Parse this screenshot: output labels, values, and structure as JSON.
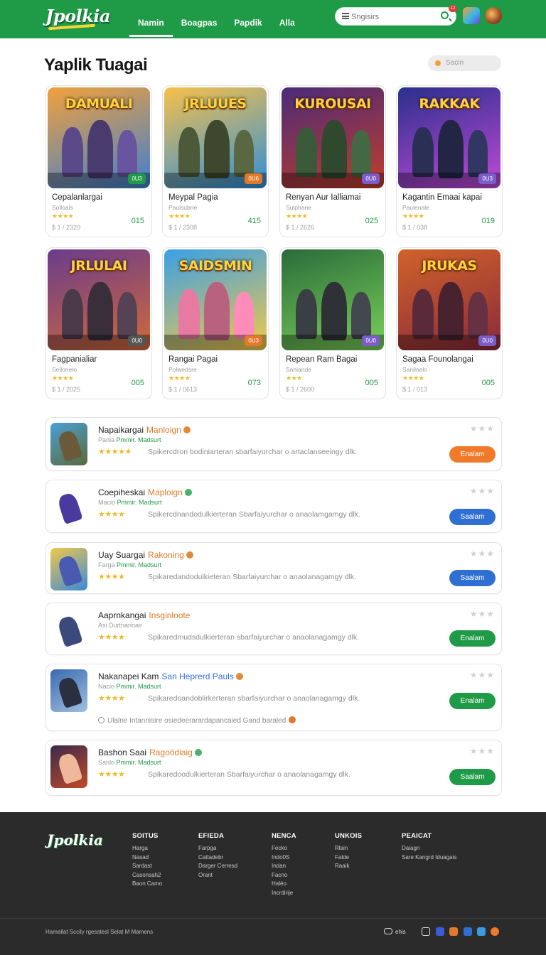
{
  "header": {
    "logo": "Jpolkia",
    "nav": [
      "Namin",
      "Boagpas",
      "Papdik",
      "Alla"
    ],
    "active_nav": 0,
    "search_placeholder": "Sngisirs",
    "notif_badge": "12"
  },
  "section": {
    "title": "Yaplik Tuagai",
    "sort_label": "Sacin"
  },
  "cards": [
    {
      "thumb_title": "DAMUALI",
      "tag": "0U3",
      "name": "Cepalanlargai",
      "sub": "Solloais",
      "stars": "★★★★",
      "price": "$ 1 / 2320",
      "score": "015",
      "colors": {
        "bg1": "#f2a13a",
        "bg2": "#3f7fd1",
        "fig": "#5b4a8a",
        "tag": "#1f9a47"
      }
    },
    {
      "thumb_title": "JRLUUES",
      "tag": "0U6",
      "name": "Meypal Pagia",
      "sub": "Paulsubne",
      "stars": "★★★★",
      "price": "$ 1 / 2308",
      "score": "415",
      "colors": {
        "bg1": "#f7c04a",
        "bg2": "#2e8fd9",
        "fig": "#4d5a3a",
        "tag": "#e07a2a"
      }
    },
    {
      "thumb_title": "KUROUSAI",
      "tag": "0U0",
      "name": "Renyan Aur Ialliamai",
      "sub": "Sulphane",
      "stars": "★★★★",
      "price": "$ 1 / 2626",
      "score": "025",
      "colors": {
        "bg1": "#4b2b7a",
        "bg2": "#c03d2a",
        "fig": "#3b5a3a",
        "tag": "#7b5cc8"
      }
    },
    {
      "thumb_title": "RAKKAK",
      "tag": "0U3",
      "name": "Kagantin Emaai kapai",
      "sub": "Paulenale",
      "stars": "★★★★",
      "price": "$ 1 / 038",
      "score": "019",
      "colors": {
        "bg1": "#2a2f8c",
        "bg2": "#c04ad6",
        "fig": "#2b2f55",
        "tag": "#7b5cc8"
      }
    },
    {
      "thumb_title": "JRLULAI",
      "tag": "0U0",
      "name": "Fagpanialiar",
      "sub": "Seilonelo",
      "stars": "★★★★",
      "price": "$ 1 / 2025",
      "score": "005",
      "colors": {
        "bg1": "#6b3b8c",
        "bg2": "#d06a3a",
        "fig": "#4a3a4a",
        "tag": "#555555"
      }
    },
    {
      "thumb_title": "SAIDSMIN",
      "tag": "0U3",
      "name": "Rangai Pagai",
      "sub": "Polwedsre",
      "stars": "★★★★",
      "price": "$ 1 / 0613",
      "score": "073",
      "colors": {
        "bg1": "#3aa0e6",
        "bg2": "#f2c84a",
        "fig": "#e77aa0",
        "tag": "#e07a2a"
      }
    },
    {
      "thumb_title": "",
      "tag": "0U0",
      "name": "Repean Ram Bagai",
      "sub": "Saniande",
      "stars": "★★★",
      "price": "$ 1 / 2600",
      "score": "005",
      "colors": {
        "bg1": "#2a6b3a",
        "bg2": "#7ad05a",
        "fig": "#3a3f44",
        "tag": "#7b5cc8"
      }
    },
    {
      "thumb_title": "JRUKAS",
      "tag": "0U0",
      "name": "Sagaa Founolangai",
      "sub": "Sanilnelo",
      "stars": "★★★★",
      "price": "$ 1 / 013",
      "score": "005",
      "colors": {
        "bg1": "#d0622a",
        "bg2": "#8a2a3a",
        "fig": "#5a2a3a",
        "tag": "#7b5cc8"
      }
    }
  ],
  "rows": [
    {
      "name": "Napaikargai",
      "accent": "Manloign",
      "accent_color": "#e07a2a",
      "sub1": "Panla",
      "sub2": "Pmmir. Madsurt",
      "stars": "★★★★★",
      "desc": "Spikercdron bodiniarteran sbarfaiyurchar o artaclanseeingy dlk.",
      "rating": "★★★",
      "button": "Enalam",
      "btn_color": "#f07a2a",
      "badge_color": "#e08a3a",
      "icon": {
        "bg1": "#4aa0d6",
        "bg2": "#5a6a3a",
        "fig": "#6b5a3a"
      }
    },
    {
      "name": "Coepiheskai",
      "accent": "Maploign",
      "accent_color": "#e07a2a",
      "sub1": "Macio",
      "sub2": "Pmmir. Madsurt",
      "stars": "★★★★",
      "desc": "Spikercdnandodulkierteran Sbarfaiyurchar o anaolamgamgy dlk.",
      "rating": "★★★",
      "button": "Saalam",
      "btn_color": "#2f6fd1",
      "badge_color": "#4ab06a",
      "icon": {
        "bg1": "#ffffff",
        "bg2": "#ffffff",
        "fig": "#4a3aa0"
      }
    },
    {
      "name": "Uay Suargai",
      "accent": "Rakoning",
      "accent_color": "#e07a2a",
      "sub1": "Farga",
      "sub2": "Pmmir. Madsurt",
      "stars": "★★★★",
      "desc": "Spikaredandodulkieteran Sbarfaiyurchar o anaolanagamgy dlk.",
      "rating": "★★★",
      "button": "Saalam",
      "btn_color": "#2f6fd1",
      "badge_color": "#e08a3a",
      "icon": {
        "bg1": "#f2c84a",
        "bg2": "#3a8ad6",
        "fig": "#4a5ab0"
      }
    },
    {
      "name": "Aaprnkangai",
      "accent": "Insginloote",
      "accent_color": "#e07a2a",
      "sub1": "Asi Durtnarioair",
      "sub2": "",
      "stars": "★★★★",
      "desc": "Spikaredmudsdulkierteran sbarfaiyurchar o anaolanagamgy dlk.",
      "rating": "★★★",
      "button": "Enalam",
      "btn_color": "#1f9a47",
      "badge_color": "",
      "icon": {
        "bg1": "#ffffff",
        "bg2": "#ffffff",
        "fig": "#3a4a7a"
      }
    },
    {
      "name": "Nakanapei Kam",
      "accent": "San Heprerd Pauls",
      "accent_color": "#2f6fd1",
      "sub1": "Nacio",
      "sub2": "Pmmir. Madsurt",
      "stars": "★★★★",
      "desc": "Spikaredoandoblirkerteran sbarfaiyurchar o anaolanagamgy dlk.",
      "rating": "★★★",
      "button": "Enalam",
      "btn_color": "#1f9a47",
      "badge_color": "#e08a3a",
      "note": "Ulalne Intannisire osiedeerarardapancaied Gand baraled",
      "icon": {
        "bg1": "#3a6ab0",
        "bg2": "#a0c0e0",
        "fig": "#2a3040"
      }
    },
    {
      "name": "Bashon Saai",
      "accent": "Ragoödiaig",
      "accent_color": "#e07a2a",
      "sub1": "Sanlo",
      "sub2": "Pmmir. Madsurt",
      "stars": "★★★★",
      "desc": "Spikaredoodulkierteran Sbarfaiyurchar o anaolanagamgy dlk.",
      "rating": "★★★",
      "button": "Saalam",
      "btn_color": "#1f9a47",
      "badge_color": "#4ab06a",
      "icon": {
        "bg1": "#3a2a4a",
        "bg2": "#c04a2a",
        "fig": "#f0b89a"
      }
    }
  ],
  "footer": {
    "logo": "Jpolkia",
    "columns": [
      {
        "title": "SOITUS",
        "items": [
          "Harga",
          "Nasad",
          "Sardast",
          "Casonsah2",
          "Baon Camo"
        ]
      },
      {
        "title": "EFIEDA",
        "items": [
          "Farpga",
          "Cattadebr",
          "Darger Cerresd",
          "Orant"
        ]
      },
      {
        "title": "NENCA",
        "items": [
          "Fecko",
          "Indo0S",
          "Indan",
          "Facno",
          "Haléo",
          "Incrdirije"
        ]
      },
      {
        "title": "UNKOIS",
        "items": [
          "Rlain",
          "Falde",
          "Raaik"
        ]
      },
      {
        "title": "PEAICAT",
        "items": [
          "Daiagn",
          "Sare Kangrd Iduagais"
        ]
      }
    ],
    "copyright": "Hamallat Sccily rgesstesl Selat M Mamens",
    "lang": "ehis",
    "social_colors": [
      "#3b5bdb",
      "#e07a2a",
      "#2f6fd1",
      "#3b9ae0",
      "#f07a2a"
    ]
  }
}
